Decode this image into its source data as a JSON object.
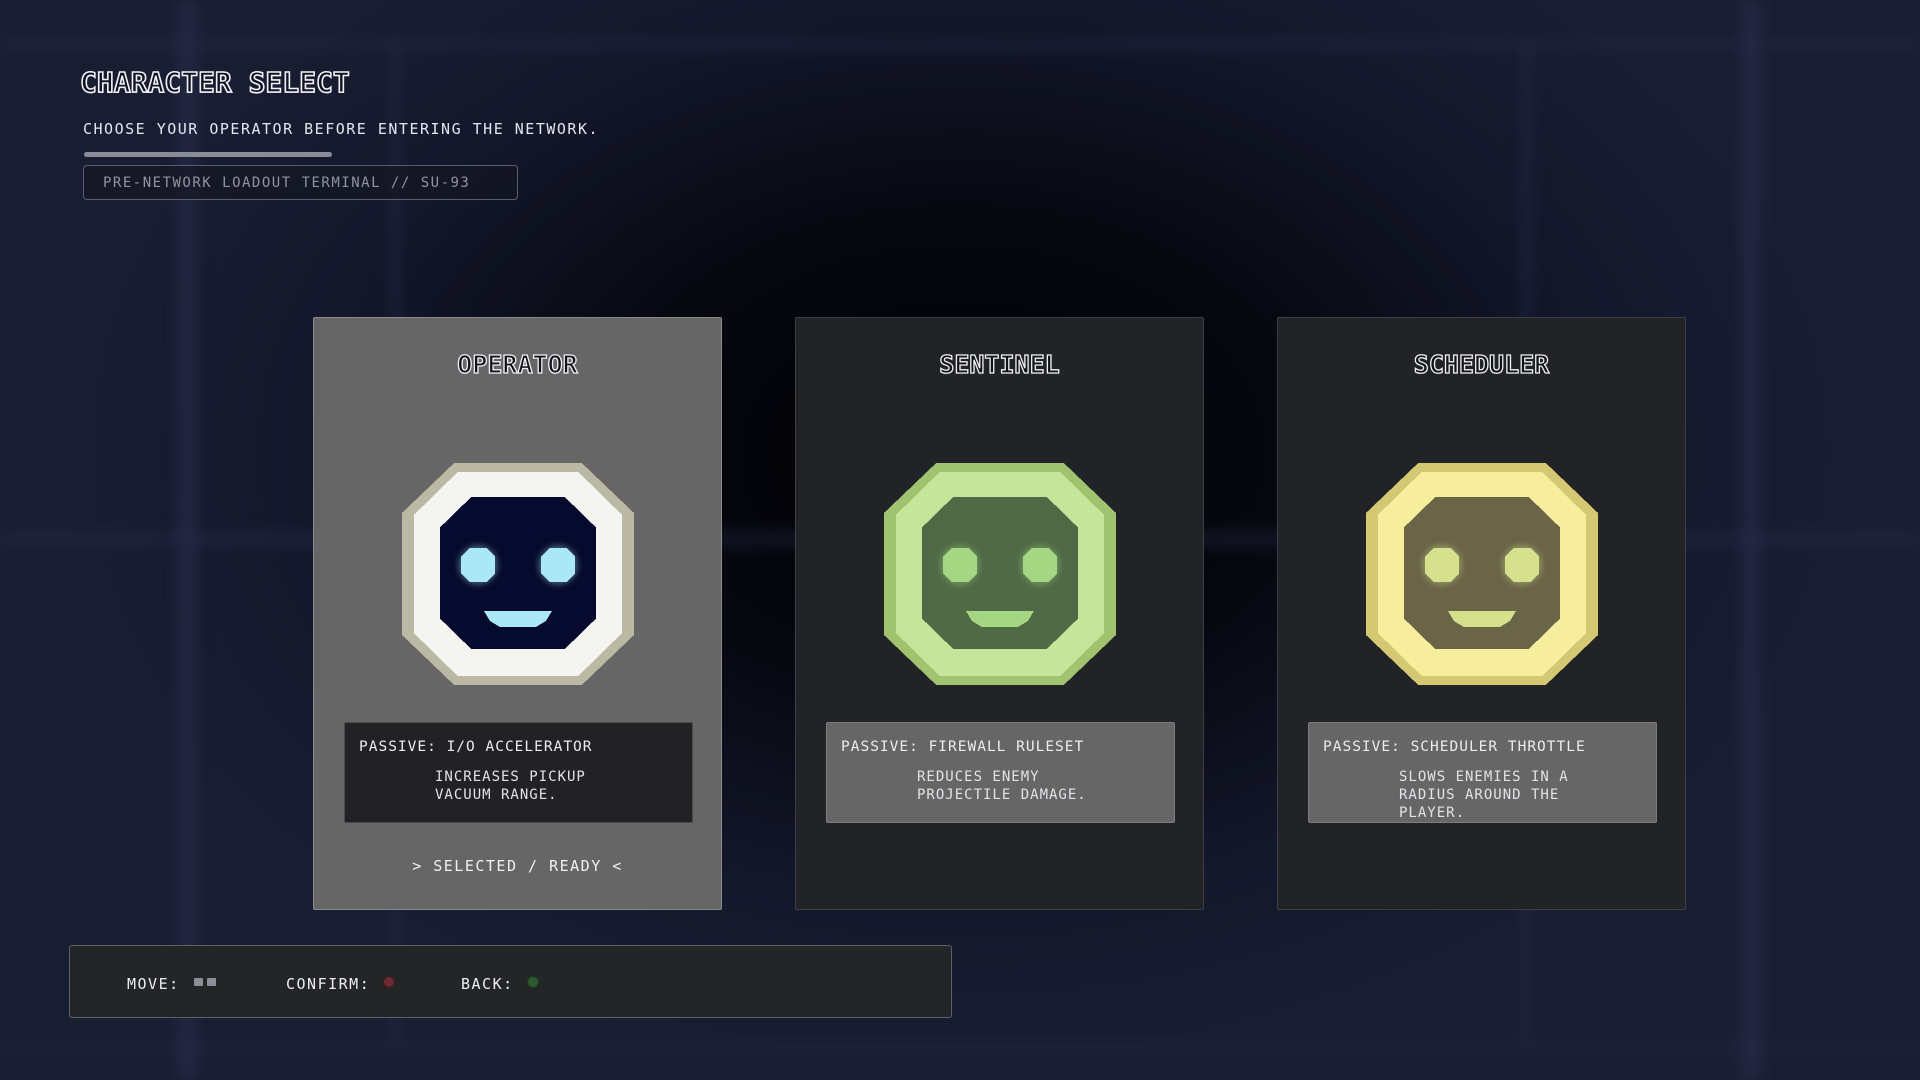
{
  "header": {
    "title": "CHARACTER SELECT",
    "subtitle": "CHOOSE YOUR OPERATOR BEFORE ENTERING THE NETWORK.",
    "terminal_label": "PRE-NETWORK LOADOUT TERMINAL // SU-93"
  },
  "characters": [
    {
      "name": "OPERATOR",
      "selected": true,
      "passive_title": "PASSIVE: I/O ACCELERATOR",
      "passive_desc": "INCREASES PICKUP VACUUM RANGE.",
      "status": "> SELECTED / READY <",
      "icon": "operator-face-icon",
      "colors": {
        "shell": "#f4f4f1",
        "rim": "#bbb9a4",
        "visor": "#060a2e",
        "glow": "#a9e8f4"
      }
    },
    {
      "name": "SENTINEL",
      "selected": false,
      "passive_title": "PASSIVE: FIREWALL RULESET",
      "passive_desc": "REDUCES ENEMY PROJECTILE DAMAGE.",
      "status": "",
      "icon": "sentinel-face-icon",
      "colors": {
        "shell": "#c6e59b",
        "rim": "#9fc36e",
        "visor": "#506a46",
        "glow": "#a5d684"
      }
    },
    {
      "name": "SCHEDULER",
      "selected": false,
      "passive_title": "PASSIVE: SCHEDULER THROTTLE",
      "passive_desc": "SLOWS ENEMIES IN A RADIUS AROUND THE PLAYER.",
      "status": "",
      "icon": "scheduler-face-icon",
      "colors": {
        "shell": "#f6ee9d",
        "rim": "#d4c872",
        "visor": "#6b6548",
        "glow": "#d6e18e"
      }
    }
  ],
  "controls": {
    "move_label": "MOVE:",
    "move_icon": "dpad-keys-icon",
    "confirm_label": "CONFIRM:",
    "confirm_icon": "a-button-icon",
    "back_label": "BACK:",
    "back_icon": "b-button-icon"
  }
}
